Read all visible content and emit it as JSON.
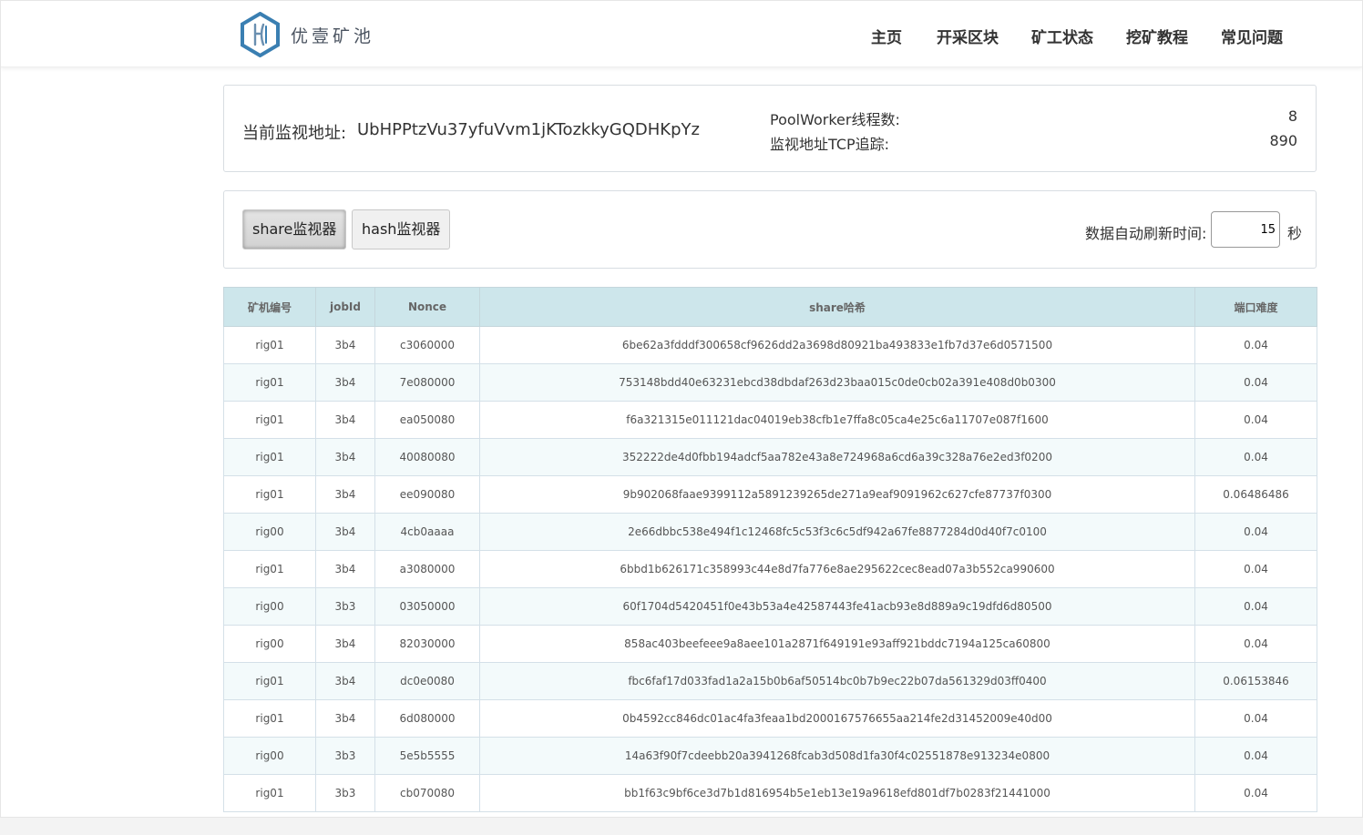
{
  "brand": {
    "name": "优壹矿池",
    "logo_color": "#3a7fb2"
  },
  "nav": {
    "items": [
      {
        "label": "主页"
      },
      {
        "label": "开采区块"
      },
      {
        "label": "矿工状态"
      },
      {
        "label": "挖矿教程"
      },
      {
        "label": "常见问题"
      }
    ]
  },
  "monitor": {
    "address_label": "当前监视地址:",
    "address_value": "UbHPPtzVu37yfuVvm1jKTozkkyGQDHKpYz",
    "stats": [
      {
        "label": "PoolWorker线程数:",
        "value": "8"
      },
      {
        "label": "监视地址TCP追踪:",
        "value": "890"
      }
    ]
  },
  "controls": {
    "share_button": "share监视器",
    "hash_button": "hash监视器",
    "refresh_label": "数据自动刷新时间:",
    "refresh_value": "15",
    "refresh_unit": "秒"
  },
  "table": {
    "headers": [
      "矿机编号",
      "jobId",
      "Nonce",
      "share哈希",
      "端口难度"
    ],
    "rows": [
      [
        "rig01",
        "3b4",
        "c3060000",
        "6be62a3fdddf300658cf9626dd2a3698d80921ba493833e1fb7d37e6d0571500",
        "0.04"
      ],
      [
        "rig01",
        "3b4",
        "7e080000",
        "753148bdd40e63231ebcd38dbdaf263d23baa015c0de0cb02a391e408d0b0300",
        "0.04"
      ],
      [
        "rig01",
        "3b4",
        "ea050080",
        "f6a321315e011121dac04019eb38cfb1e7ffa8c05ca4e25c6a11707e087f1600",
        "0.04"
      ],
      [
        "rig01",
        "3b4",
        "40080080",
        "352222de4d0fbb194adcf5aa782e43a8e724968a6cd6a39c328a76e2ed3f0200",
        "0.04"
      ],
      [
        "rig01",
        "3b4",
        "ee090080",
        "9b902068faae9399112a5891239265de271a9eaf9091962c627cfe87737f0300",
        "0.06486486"
      ],
      [
        "rig00",
        "3b4",
        "4cb0aaaa",
        "2e66dbbc538e494f1c12468fc5c53f3c6c5df942a67fe8877284d0d40f7c0100",
        "0.04"
      ],
      [
        "rig01",
        "3b4",
        "a3080000",
        "6bbd1b626171c358993c44e8d7fa776e8ae295622cec8ead07a3b552ca990600",
        "0.04"
      ],
      [
        "rig00",
        "3b3",
        "03050000",
        "60f1704d5420451f0e43b53a4e42587443fe41acb93e8d889a9c19dfd6d80500",
        "0.04"
      ],
      [
        "rig00",
        "3b4",
        "82030000",
        "858ac403beefeee9a8aee101a2871f649191e93aff921bddc7194a125ca60800",
        "0.04"
      ],
      [
        "rig01",
        "3b4",
        "dc0e0080",
        "fbc6faf17d033fad1a2a15b0b6af50514bc0b7b9ec22b07da561329d03ff0400",
        "0.06153846"
      ],
      [
        "rig01",
        "3b4",
        "6d080000",
        "0b4592cc846dc01ac4fa3feaa1bd2000167576655aa214fe2d31452009e40d00",
        "0.04"
      ],
      [
        "rig00",
        "3b3",
        "5e5b5555",
        "14a63f90f7cdeebb20a3941268fcab3d508d1fa30f4c02551878e913234e0800",
        "0.04"
      ],
      [
        "rig01",
        "3b3",
        "cb070080",
        "bb1f63c9bf6ce3d7b1d816954b5e1eb13e19a9618efd801df7b0283f21441000",
        "0.04"
      ]
    ]
  }
}
